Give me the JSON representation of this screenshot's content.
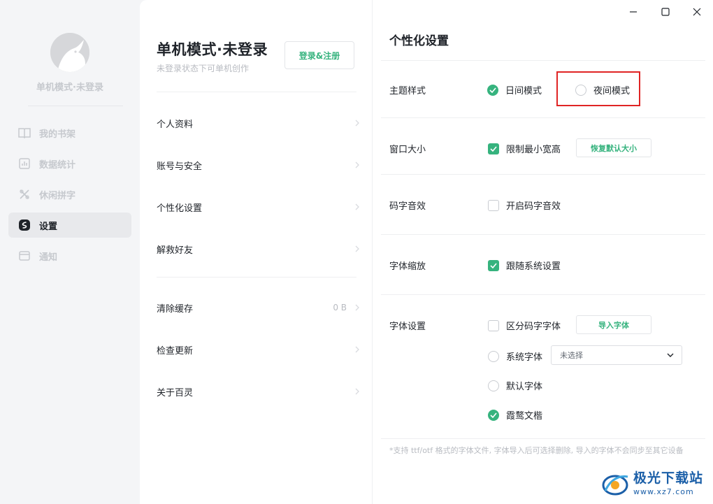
{
  "sidebar": {
    "username": "单机模式·未登录",
    "items": [
      {
        "label": "我的书架",
        "icon": "book-icon",
        "active": false
      },
      {
        "label": "数据统计",
        "icon": "chart-icon",
        "active": false
      },
      {
        "label": "休闲拼字",
        "icon": "puzzle-icon",
        "active": false
      },
      {
        "label": "设置",
        "icon": "settings-icon",
        "active": true
      },
      {
        "label": "通知",
        "icon": "message-icon",
        "active": false
      }
    ]
  },
  "account": {
    "title": "单机模式·未登录",
    "subtitle": "未登录状态下可单机创作",
    "login_label": "登录&注册"
  },
  "menu": {
    "profile": "个人资料",
    "security": "账号与安全",
    "personalize": "个性化设置",
    "rescue": "解救好友",
    "cache": "清除缓存",
    "cache_size": "0 B",
    "update": "检查更新",
    "about": "关于百灵"
  },
  "settings": {
    "title": "个性化设置",
    "theme": {
      "label": "主题样式",
      "day": "日间模式",
      "night": "夜间模式",
      "selected": "day"
    },
    "window": {
      "label": "窗口大小",
      "limit_label": "限制最小宽高",
      "limit_checked": true,
      "reset_label": "恢复默认大小"
    },
    "sound": {
      "label": "码字音效",
      "enable_label": "开启码字音效",
      "enable_checked": false
    },
    "scale": {
      "label": "字体缩放",
      "follow_label": "跟随系统设置",
      "follow_checked": true
    },
    "font": {
      "label": "字体设置",
      "distinct_label": "区分码字字体",
      "distinct_checked": false,
      "import_label": "导入字体",
      "system_label": "系统字体",
      "system_value": "未选择",
      "default_label": "默认字体",
      "lxgw_label": "霞鹜文楷",
      "selected": "lxgw"
    },
    "note": "*支持 ttf/otf 格式的字体文件, 字体导入后可选择删除, 导入的字体不会同步至其它设备"
  },
  "watermark": {
    "main": "极光下载站",
    "url": "www.xz7.com"
  },
  "colors": {
    "accent": "#36b37e",
    "highlight": "#e02424"
  }
}
